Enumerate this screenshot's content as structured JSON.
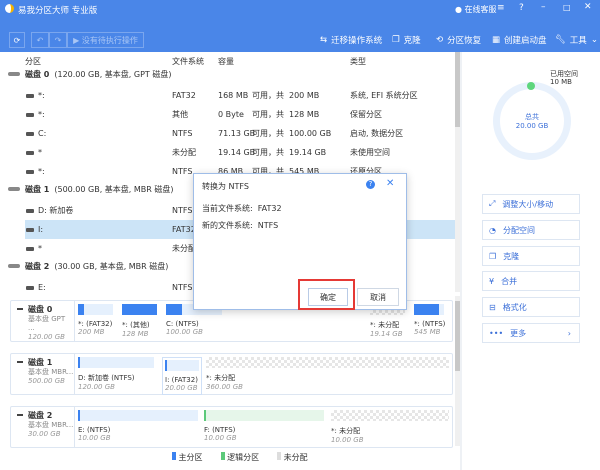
{
  "app": {
    "title": "易我分区大师 专业版",
    "online_service": "在线客服"
  },
  "toolbar": {
    "pending": "没有待执行操作",
    "tools": [
      "迁移操作系统",
      "克隆",
      "分区恢复",
      "创建启动盘",
      "工具"
    ]
  },
  "columns": [
    "分区",
    "文件系统",
    "容量",
    "类型"
  ],
  "disks": [
    {
      "label": "磁盘 0",
      "info": "(120.00 GB, 基本盘, GPT 磁盘)",
      "partitions": [
        {
          "name": "*:",
          "fs": "FAT32",
          "free": "168 MB",
          "mid": "可用，共",
          "total": "200 MB",
          "type": "系统, EFI 系统分区"
        },
        {
          "name": "*:",
          "fs": "其他",
          "free": "0 Byte",
          "mid": "可用，共",
          "total": "128 MB",
          "type": "保留分区"
        },
        {
          "name": "C:",
          "fs": "NTFS",
          "free": "71.13 GB",
          "mid": "可用，共",
          "total": "100.00 GB",
          "type": "启动, 数据分区"
        },
        {
          "name": "*",
          "fs": "未分配",
          "free": "19.14 GB",
          "mid": "可用，共",
          "total": "19.14 GB",
          "type": "未使用空间"
        },
        {
          "name": "*:",
          "fs": "NTFS",
          "free": "86 MB",
          "mid": "可用，共",
          "total": "545 MB",
          "type": "还原分区"
        }
      ]
    },
    {
      "label": "磁盘 1",
      "info": "(500.00 GB, 基本盘, MBR 磁盘)",
      "partitions": [
        {
          "name": "D: 新加卷",
          "fs": "NTFS"
        },
        {
          "name": "I:",
          "fs": "FAT32"
        },
        {
          "name": "*",
          "fs": "未分配"
        }
      ]
    },
    {
      "label": "磁盘 2",
      "info": "(30.00 GB, 基本盘, MBR 磁盘)",
      "partitions": [
        {
          "name": "E:",
          "fs": "NTFS"
        }
      ]
    }
  ],
  "cards": [
    {
      "title": "磁盘 0",
      "sub": "基本盘 GPT ...",
      "size": "120.00 GB",
      "segs": [
        {
          "n": "*: (FAT32)",
          "s": "200 MB",
          "fill": 16
        },
        {
          "n": "*: (其他)",
          "s": "128 MB",
          "fill": 100
        },
        {
          "n": "C: (NTFS)",
          "s": "100.00 GB",
          "fill": 29
        },
        {
          "n": "*: 未分配",
          "s": "19.14 GB",
          "fill": 0
        },
        {
          "n": "*: (NTFS)",
          "s": "545 MB",
          "fill": 84
        }
      ]
    },
    {
      "title": "磁盘 1",
      "sub": "基本盘 MBR...",
      "size": "500.00 GB",
      "segs": [
        {
          "n": "D: 新加卷 (NTFS)",
          "s": "120.00 GB",
          "fill": 1
        },
        {
          "n": "I: (FAT32)",
          "s": "20.00 GB",
          "fill": 1
        },
        {
          "n": "*: 未分配",
          "s": "360.00 GB",
          "fill": 0
        }
      ]
    },
    {
      "title": "磁盘 2",
      "sub": "基本盘 MBR...",
      "size": "30.00 GB",
      "segs": [
        {
          "n": "E: (NTFS)",
          "s": "10.00 GB",
          "fill": 1
        },
        {
          "n": "F: (NTFS)",
          "s": "10.00 GB",
          "fill": 1
        },
        {
          "n": "*: 未分配",
          "s": "10.00 GB",
          "fill": 0
        }
      ]
    }
  ],
  "legend": [
    "主分区",
    "逻辑分区",
    "未分配"
  ],
  "side": {
    "used_label": "已用空间",
    "used": "10 MB",
    "total_label": "总共",
    "total": "20.00 GB",
    "actions": [
      "调整大小/移动",
      "分配空间",
      "克隆",
      "合并",
      "格式化",
      "更多"
    ]
  },
  "dialog": {
    "title": "转换为 NTFS",
    "current_label": "当前文件系统:",
    "current": "FAT32",
    "new_label": "新的文件系统:",
    "new": "NTFS",
    "ok": "确定",
    "cancel": "取消"
  },
  "colors": {
    "header": "#4a86e8",
    "primary": "#3b82f0",
    "logical": "#5cc97a",
    "highlight": "#e53935"
  }
}
